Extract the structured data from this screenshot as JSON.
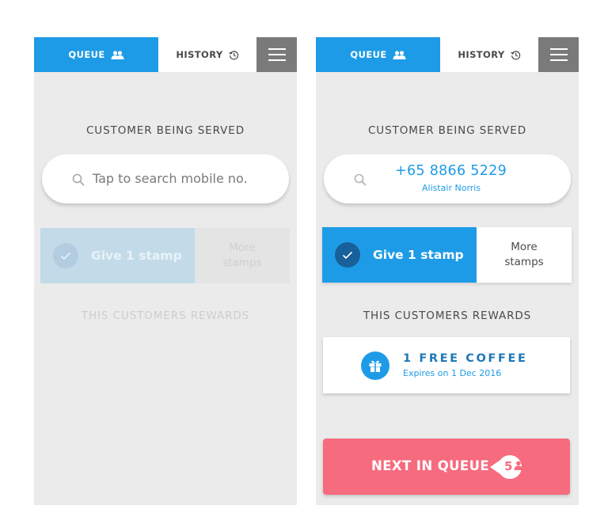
{
  "screens": [
    {
      "id": "empty",
      "tabs": {
        "queue": "QUEUE",
        "history": "HISTORY"
      },
      "heading": "CUSTOMER BEING SERVED",
      "search": {
        "placeholder": "Tap to search mobile no."
      },
      "stamp": {
        "give": "Give 1 stamp",
        "more_line1": "More",
        "more_line2": "stamps"
      },
      "rewards_heading": "THIS CUSTOMERS REWARDS"
    },
    {
      "id": "served",
      "tabs": {
        "queue": "QUEUE",
        "history": "HISTORY"
      },
      "heading": "CUSTOMER BEING SERVED",
      "customer": {
        "phone": "+65 8866 5229",
        "name": "Alistair Norris"
      },
      "stamp": {
        "give": "Give 1 stamp",
        "more_line1": "More",
        "more_line2": "stamps"
      },
      "rewards_heading": "THIS CUSTOMERS REWARDS",
      "reward": {
        "title": "1 FREE COFFEE",
        "expiry": "Expires on 1 Dec 2016",
        "icon": "gift-icon"
      },
      "next": {
        "label": "NEXT IN QUEUE",
        "count": "5"
      }
    }
  ],
  "icons": {
    "queue": "people-icon",
    "history": "history-icon",
    "menu": "hamburger-icon",
    "search": "search-icon",
    "check": "check-icon",
    "gift": "gift-icon"
  },
  "colors": {
    "primary": "#1e9be6",
    "primary_dark": "#17609a",
    "accent": "#f76b7f",
    "menu_bg": "#7a7a7a",
    "background": "#ebebeb",
    "disabled": "#c3dbe9"
  }
}
